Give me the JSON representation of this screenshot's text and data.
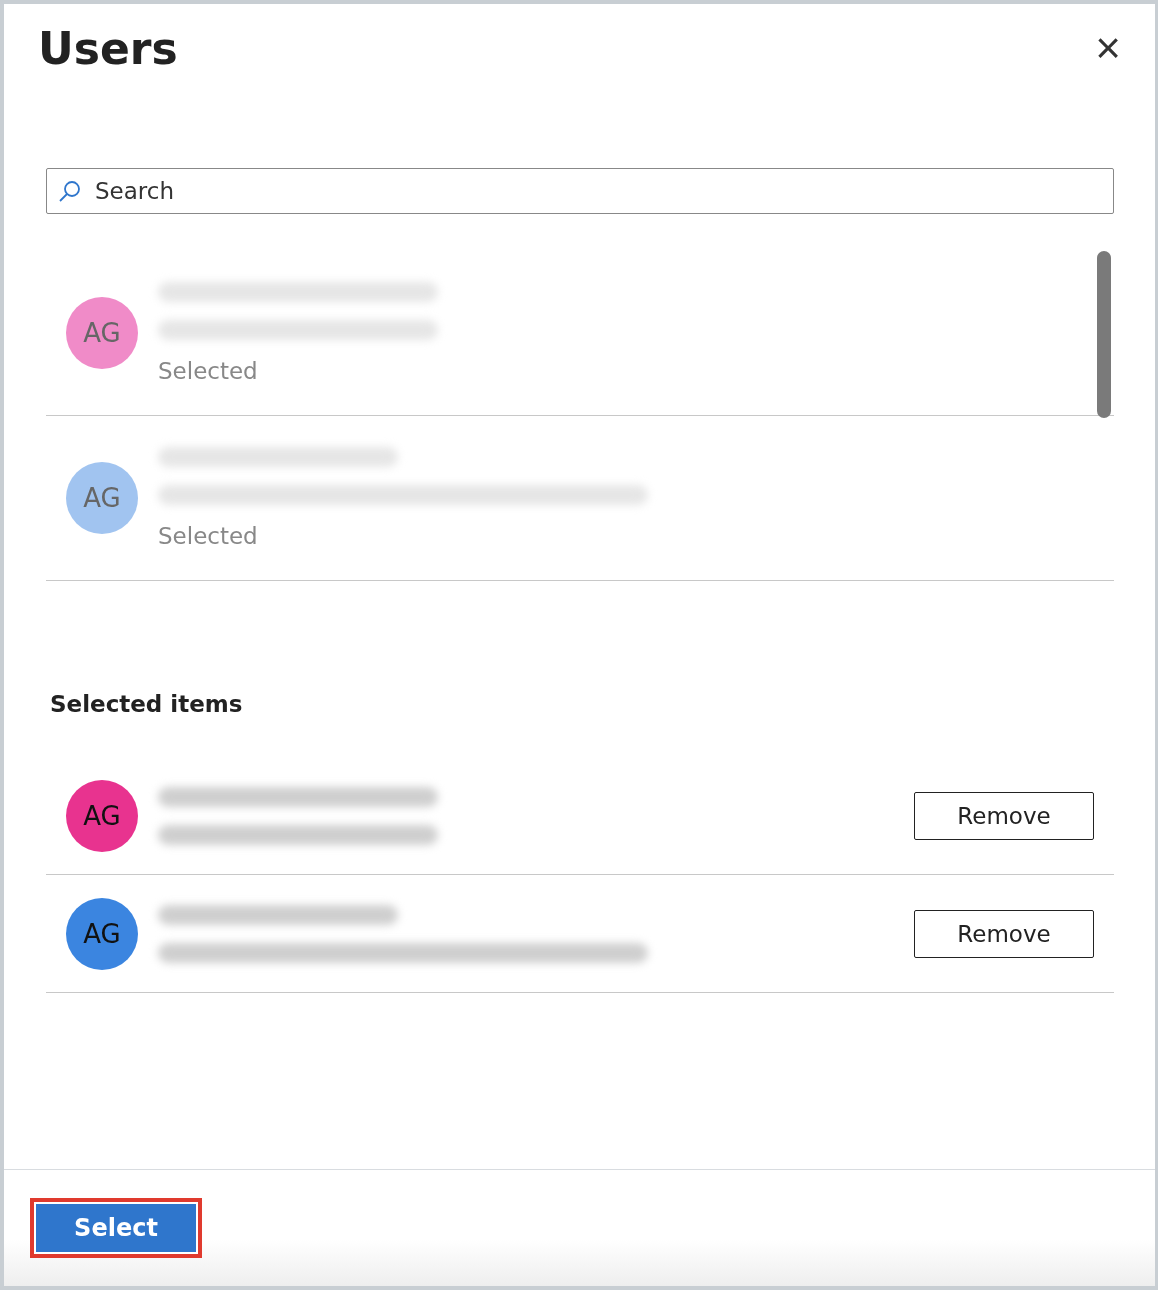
{
  "panel": {
    "title": "Users",
    "close_label": "×"
  },
  "search": {
    "placeholder": "Search"
  },
  "results": [
    {
      "initials": "AG",
      "color": "#f08bc8",
      "dimmed": true,
      "status": "Selected",
      "lines": [
        {
          "kind": "short"
        },
        {
          "kind": "short"
        }
      ]
    },
    {
      "initials": "AG",
      "color": "#a1c4f0",
      "dimmed": true,
      "status": "Selected",
      "lines": [
        {
          "kind": "medium"
        },
        {
          "kind": "long"
        }
      ]
    }
  ],
  "selected_items": {
    "heading": "Selected items",
    "items": [
      {
        "initials": "AG",
        "color": "#e8338f",
        "lines": [
          {
            "kind": "short"
          },
          {
            "kind": "short"
          }
        ],
        "button": "Remove"
      },
      {
        "initials": "AG",
        "color": "#3b85e0",
        "lines": [
          {
            "kind": "medium"
          },
          {
            "kind": "long"
          }
        ],
        "button": "Remove"
      }
    ]
  },
  "footer": {
    "button": "Select",
    "highlighted": true
  }
}
